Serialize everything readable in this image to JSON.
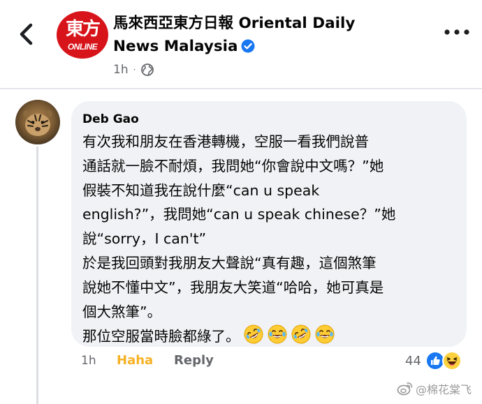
{
  "header": {
    "back_icon": "chevron-left-icon",
    "page_logo": {
      "text_top": "東方",
      "text_bottom": "ONLINE",
      "color": "#d8141b"
    },
    "page_name": "馬來西亞東方日報 Oriental Daily News Malaysia",
    "verified_icon": "verified-badge-icon",
    "verified_color": "#1877f2",
    "post_time": "1h",
    "separator": "·",
    "audience_icon": "globe-icon",
    "more_icon": "more-options-icon"
  },
  "comment": {
    "author": "Deb Gao",
    "avatar_icon": "tiger-avatar",
    "lines": [
      "有次我和朋友在香港轉機，空服一看我們說普",
      "通話就一臉不耐煩，我問她“你會說中文嗎？”她",
      "假裝不知道我在說什麼“can u speak",
      "english?”，我問她“can u speak chinese？”她",
      "說“sorry，I can't”",
      "於是我回頭對我朋友大聲說“真有趣，這個煞筆",
      "說她不懂中文”，我朋友大笑道“哈哈，她可真是",
      "個大煞筆”。",
      "那位空服當時臉都綠了。"
    ],
    "emojis": [
      "rolling-on-floor-laughing-icon",
      "tears-of-joy-icon",
      "rolling-on-floor-laughing-icon",
      "tears-of-joy-icon"
    ],
    "time": "1h",
    "reaction_label": "Haha",
    "reaction_color": "#f7b125",
    "reply_label": "Reply",
    "reaction_count": "44",
    "reaction_icons": [
      "like-reaction-icon",
      "haha-reaction-icon"
    ]
  },
  "watermark": {
    "icon": "weibo-icon",
    "text": "@棉花棠飞"
  }
}
